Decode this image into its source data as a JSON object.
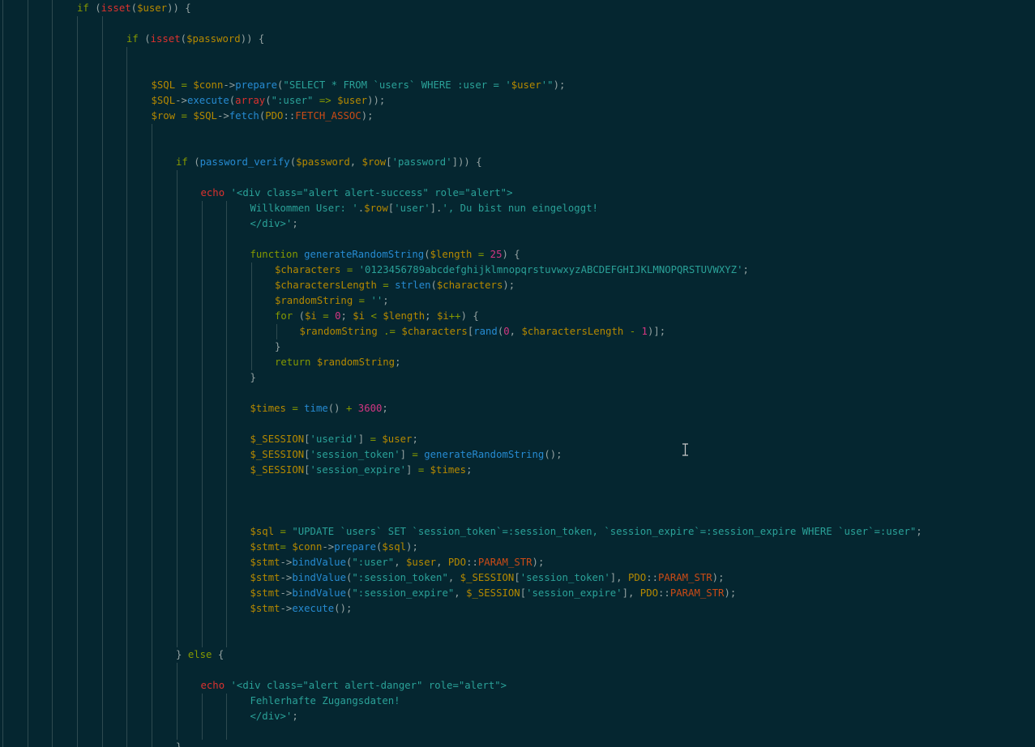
{
  "editor": {
    "language": "PHP",
    "theme": "solarized dark",
    "colors": {
      "background": "#052630",
      "default_text": "#93a1a1",
      "keyword": "#859900",
      "builtin_language_construct": "#dc322f",
      "function": "#268bd2",
      "string": "#2aa198",
      "variable": "#b58900",
      "number": "#d33682",
      "constant": "#cb4b16",
      "indent_guide": "#2e4a50"
    },
    "cursor_icon": "text-cursor-icon",
    "lines": [
      {
        "indent": 3,
        "tokens": [
          [
            "kw",
            "if"
          ],
          [
            "pl",
            " ("
          ],
          [
            "dc",
            "isset"
          ],
          [
            "pl",
            "("
          ],
          [
            "vr",
            "$user"
          ],
          [
            "pl",
            ")) {"
          ]
        ]
      },
      {
        "indent": 0,
        "tokens": []
      },
      {
        "indent": 5,
        "tokens": [
          [
            "kw",
            "if"
          ],
          [
            "pl",
            " ("
          ],
          [
            "dc",
            "isset"
          ],
          [
            "pl",
            "("
          ],
          [
            "vr",
            "$password"
          ],
          [
            "pl",
            ")) {"
          ]
        ]
      },
      {
        "indent": 0,
        "tokens": []
      },
      {
        "indent": 0,
        "tokens": []
      },
      {
        "indent": 6,
        "tokens": [
          [
            "vr",
            "$SQL"
          ],
          [
            "op",
            " = "
          ],
          [
            "vr",
            "$conn"
          ],
          [
            "pl",
            "->"
          ],
          [
            "fn",
            "prepare"
          ],
          [
            "pl",
            "("
          ],
          [
            "st",
            "\"SELECT * FROM `users` WHERE :user = '"
          ],
          [
            "vr",
            "$user"
          ],
          [
            "st",
            "'\""
          ],
          [
            "pl",
            ");"
          ]
        ]
      },
      {
        "indent": 6,
        "tokens": [
          [
            "vr",
            "$SQL"
          ],
          [
            "pl",
            "->"
          ],
          [
            "fn",
            "execute"
          ],
          [
            "pl",
            "("
          ],
          [
            "dc",
            "array"
          ],
          [
            "pl",
            "("
          ],
          [
            "st",
            "\":user\""
          ],
          [
            "op",
            " => "
          ],
          [
            "vr",
            "$user"
          ],
          [
            "pl",
            "));"
          ]
        ]
      },
      {
        "indent": 6,
        "tokens": [
          [
            "vr",
            "$row"
          ],
          [
            "op",
            " = "
          ],
          [
            "vr",
            "$SQL"
          ],
          [
            "pl",
            "->"
          ],
          [
            "fn",
            "fetch"
          ],
          [
            "pl",
            "("
          ],
          [
            "vr",
            "PDO"
          ],
          [
            "pl",
            "::"
          ],
          [
            "co",
            "FETCH_ASSOC"
          ],
          [
            "pl",
            ");"
          ]
        ]
      },
      {
        "indent": 0,
        "tokens": []
      },
      {
        "indent": 0,
        "tokens": []
      },
      {
        "indent": 7,
        "tokens": [
          [
            "kw",
            "if"
          ],
          [
            "pl",
            " ("
          ],
          [
            "fn",
            "password_verify"
          ],
          [
            "pl",
            "("
          ],
          [
            "vr",
            "$password"
          ],
          [
            "pl",
            ", "
          ],
          [
            "vr",
            "$row"
          ],
          [
            "pl",
            "["
          ],
          [
            "st",
            "'password'"
          ],
          [
            "pl",
            "])) {"
          ]
        ]
      },
      {
        "indent": 0,
        "tokens": []
      },
      {
        "indent": 8,
        "tokens": [
          [
            "dc",
            "echo"
          ],
          [
            "pl",
            " "
          ],
          [
            "st",
            "'<div class=\"alert alert-success\" role=\"alert\">"
          ]
        ]
      },
      {
        "indent": 10,
        "tokens": [
          [
            "st",
            "Willkommen User: '"
          ],
          [
            "pl",
            "."
          ],
          [
            "vr",
            "$row"
          ],
          [
            "pl",
            "["
          ],
          [
            "st",
            "'user'"
          ],
          [
            "pl",
            "]."
          ],
          [
            "st",
            "', Du bist nun eingeloggt!"
          ]
        ]
      },
      {
        "indent": 10,
        "tokens": [
          [
            "st",
            "</div>'"
          ],
          [
            "pl",
            ";"
          ]
        ]
      },
      {
        "indent": 0,
        "tokens": []
      },
      {
        "indent": 10,
        "tokens": [
          [
            "kw",
            "function"
          ],
          [
            "pl",
            " "
          ],
          [
            "fn",
            "generateRandomString"
          ],
          [
            "pl",
            "("
          ],
          [
            "vr",
            "$length"
          ],
          [
            "op",
            " = "
          ],
          [
            "nm",
            "25"
          ],
          [
            "pl",
            ") {"
          ]
        ]
      },
      {
        "indent": 11,
        "tokens": [
          [
            "vr",
            "$characters"
          ],
          [
            "op",
            " = "
          ],
          [
            "st",
            "'0123456789abcdefghijklmnopqrstuvwxyzABCDEFGHIJKLMNOPQRSTUVWXYZ'"
          ],
          [
            "pl",
            ";"
          ]
        ]
      },
      {
        "indent": 11,
        "tokens": [
          [
            "vr",
            "$charactersLength"
          ],
          [
            "op",
            " = "
          ],
          [
            "fn",
            "strlen"
          ],
          [
            "pl",
            "("
          ],
          [
            "vr",
            "$characters"
          ],
          [
            "pl",
            ");"
          ]
        ]
      },
      {
        "indent": 11,
        "tokens": [
          [
            "vr",
            "$randomString"
          ],
          [
            "op",
            " = "
          ],
          [
            "st",
            "''"
          ],
          [
            "pl",
            ";"
          ]
        ]
      },
      {
        "indent": 11,
        "tokens": [
          [
            "kw",
            "for"
          ],
          [
            "pl",
            " ("
          ],
          [
            "vr",
            "$i"
          ],
          [
            "op",
            " = "
          ],
          [
            "nm",
            "0"
          ],
          [
            "pl",
            "; "
          ],
          [
            "vr",
            "$i"
          ],
          [
            "op",
            " < "
          ],
          [
            "vr",
            "$length"
          ],
          [
            "pl",
            "; "
          ],
          [
            "vr",
            "$i"
          ],
          [
            "op",
            "++"
          ],
          [
            "pl",
            ") {"
          ]
        ]
      },
      {
        "indent": 12,
        "tokens": [
          [
            "vr",
            "$randomString"
          ],
          [
            "op",
            " .= "
          ],
          [
            "vr",
            "$characters"
          ],
          [
            "pl",
            "["
          ],
          [
            "fn",
            "rand"
          ],
          [
            "pl",
            "("
          ],
          [
            "nm",
            "0"
          ],
          [
            "pl",
            ", "
          ],
          [
            "vr",
            "$charactersLength"
          ],
          [
            "op",
            " - "
          ],
          [
            "nm",
            "1"
          ],
          [
            "pl",
            ")];"
          ]
        ]
      },
      {
        "indent": 11,
        "tokens": [
          [
            "pl",
            "}"
          ]
        ]
      },
      {
        "indent": 11,
        "tokens": [
          [
            "kw",
            "return"
          ],
          [
            "pl",
            " "
          ],
          [
            "vr",
            "$randomString"
          ],
          [
            "pl",
            ";"
          ]
        ]
      },
      {
        "indent": 10,
        "tokens": [
          [
            "pl",
            "}"
          ]
        ]
      },
      {
        "indent": 0,
        "tokens": []
      },
      {
        "indent": 10,
        "tokens": [
          [
            "vr",
            "$times"
          ],
          [
            "op",
            " = "
          ],
          [
            "fn",
            "time"
          ],
          [
            "pl",
            "()"
          ],
          [
            "op",
            " + "
          ],
          [
            "nm",
            "3600"
          ],
          [
            "pl",
            ";"
          ]
        ]
      },
      {
        "indent": 0,
        "tokens": []
      },
      {
        "indent": 10,
        "tokens": [
          [
            "vr",
            "$_SESSION"
          ],
          [
            "pl",
            "["
          ],
          [
            "st",
            "'userid'"
          ],
          [
            "pl",
            "]"
          ],
          [
            "op",
            " = "
          ],
          [
            "vr",
            "$user"
          ],
          [
            "pl",
            ";"
          ]
        ]
      },
      {
        "indent": 10,
        "tokens": [
          [
            "vr",
            "$_SESSION"
          ],
          [
            "pl",
            "["
          ],
          [
            "st",
            "'session_token'"
          ],
          [
            "pl",
            "]"
          ],
          [
            "op",
            " = "
          ],
          [
            "fn",
            "generateRandomString"
          ],
          [
            "pl",
            "();"
          ]
        ]
      },
      {
        "indent": 10,
        "tokens": [
          [
            "vr",
            "$_SESSION"
          ],
          [
            "pl",
            "["
          ],
          [
            "st",
            "'session_expire'"
          ],
          [
            "pl",
            "]"
          ],
          [
            "op",
            " = "
          ],
          [
            "vr",
            "$times"
          ],
          [
            "pl",
            ";"
          ]
        ]
      },
      {
        "indent": 0,
        "tokens": []
      },
      {
        "indent": 0,
        "tokens": []
      },
      {
        "indent": 0,
        "tokens": []
      },
      {
        "indent": 10,
        "tokens": [
          [
            "vr",
            "$sql"
          ],
          [
            "op",
            " = "
          ],
          [
            "st",
            "\"UPDATE `users` SET `session_token`=:session_token, `session_expire`=:session_expire WHERE `user`=:user\""
          ],
          [
            "pl",
            ";"
          ]
        ]
      },
      {
        "indent": 10,
        "tokens": [
          [
            "vr",
            "$stmt"
          ],
          [
            "op",
            "= "
          ],
          [
            "vr",
            "$conn"
          ],
          [
            "pl",
            "->"
          ],
          [
            "fn",
            "prepare"
          ],
          [
            "pl",
            "("
          ],
          [
            "vr",
            "$sql"
          ],
          [
            "pl",
            ");"
          ]
        ]
      },
      {
        "indent": 10,
        "tokens": [
          [
            "vr",
            "$stmt"
          ],
          [
            "pl",
            "->"
          ],
          [
            "fn",
            "bindValue"
          ],
          [
            "pl",
            "("
          ],
          [
            "st",
            "\":user\""
          ],
          [
            "pl",
            ", "
          ],
          [
            "vr",
            "$user"
          ],
          [
            "pl",
            ", "
          ],
          [
            "vr",
            "PDO"
          ],
          [
            "pl",
            "::"
          ],
          [
            "co",
            "PARAM_STR"
          ],
          [
            "pl",
            ");"
          ]
        ]
      },
      {
        "indent": 10,
        "tokens": [
          [
            "vr",
            "$stmt"
          ],
          [
            "pl",
            "->"
          ],
          [
            "fn",
            "bindValue"
          ],
          [
            "pl",
            "("
          ],
          [
            "st",
            "\":session_token\""
          ],
          [
            "pl",
            ", "
          ],
          [
            "vr",
            "$_SESSION"
          ],
          [
            "pl",
            "["
          ],
          [
            "st",
            "'session_token'"
          ],
          [
            "pl",
            "], "
          ],
          [
            "vr",
            "PDO"
          ],
          [
            "pl",
            "::"
          ],
          [
            "co",
            "PARAM_STR"
          ],
          [
            "pl",
            ");"
          ]
        ]
      },
      {
        "indent": 10,
        "tokens": [
          [
            "vr",
            "$stmt"
          ],
          [
            "pl",
            "->"
          ],
          [
            "fn",
            "bindValue"
          ],
          [
            "pl",
            "("
          ],
          [
            "st",
            "\":session_expire\""
          ],
          [
            "pl",
            ", "
          ],
          [
            "vr",
            "$_SESSION"
          ],
          [
            "pl",
            "["
          ],
          [
            "st",
            "'session_expire'"
          ],
          [
            "pl",
            "], "
          ],
          [
            "vr",
            "PDO"
          ],
          [
            "pl",
            "::"
          ],
          [
            "co",
            "PARAM_STR"
          ],
          [
            "pl",
            ");"
          ]
        ]
      },
      {
        "indent": 10,
        "tokens": [
          [
            "vr",
            "$stmt"
          ],
          [
            "pl",
            "->"
          ],
          [
            "fn",
            "execute"
          ],
          [
            "pl",
            "();"
          ]
        ]
      },
      {
        "indent": 0,
        "tokens": []
      },
      {
        "indent": 0,
        "tokens": []
      },
      {
        "indent": 7,
        "tokens": [
          [
            "pl",
            "} "
          ],
          [
            "kw",
            "else"
          ],
          [
            "pl",
            " {"
          ]
        ]
      },
      {
        "indent": 0,
        "tokens": []
      },
      {
        "indent": 8,
        "tokens": [
          [
            "dc",
            "echo"
          ],
          [
            "pl",
            " "
          ],
          [
            "st",
            "'<div class=\"alert alert-danger\" role=\"alert\">"
          ]
        ]
      },
      {
        "indent": 10,
        "tokens": [
          [
            "st",
            "Fehlerhafte Zugangsdaten!"
          ]
        ]
      },
      {
        "indent": 10,
        "tokens": [
          [
            "st",
            "</div>'"
          ],
          [
            "pl",
            ";"
          ]
        ]
      },
      {
        "indent": 0,
        "tokens": []
      },
      {
        "indent": 7,
        "tokens": [
          [
            "pl",
            "}"
          ]
        ]
      }
    ]
  }
}
